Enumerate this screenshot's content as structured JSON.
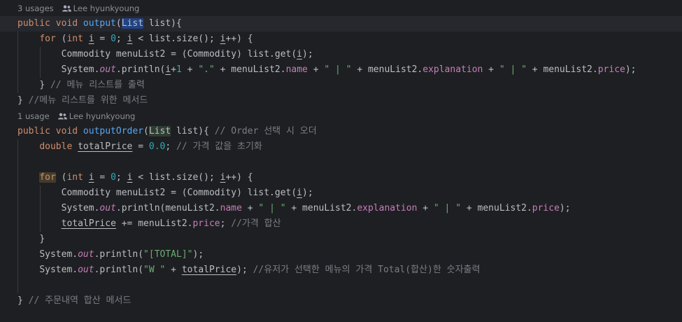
{
  "editor": {
    "hint1": {
      "usages": "3 usages",
      "author": "Lee hyunkyoung"
    },
    "hint2": {
      "usages": "1 usage",
      "author": "Lee hyunkyoung"
    },
    "code": {
      "l1": {
        "a": "public void ",
        "b": "output",
        "c": "(",
        "d": "List",
        "e": " list){"
      },
      "l2": {
        "a": "for",
        "b": " (",
        "c": "int",
        "d": " ",
        "e": "i",
        "f": " = ",
        "g": "0",
        "h": "; ",
        "i": "i",
        "j": " < list.size(); ",
        "k": "i",
        "l": "++) {"
      },
      "l3": {
        "a": "Commodity menuList2 = (Commodity) list.get(",
        "b": "i",
        "c": ");"
      },
      "l4": {
        "a": "System.",
        "b": "out",
        "c": ".println(",
        "d": "i",
        "e": "+",
        "f": "1",
        "g": " + ",
        "h": "\".\"",
        "i": " + menuList2.",
        "j": "name",
        "k": " + ",
        "l": "\" | \"",
        "m": " + menuList2.",
        "n": "explanation",
        "o": " + ",
        "p": "\" | \"",
        "q": " + menuList2.",
        "r": "price",
        "s": ");"
      },
      "l5": {
        "a": "} ",
        "b": "// 메뉴 리스트를 출력"
      },
      "l6": {
        "a": "} ",
        "b": "//메뉴 리스트를 위한 메서드"
      },
      "l7": {
        "a": "public void ",
        "b": "outputOrder",
        "c": "(",
        "d": "List",
        "e": " list){ ",
        "f": "// Order 선택 시 오더"
      },
      "l8": {
        "a": "double ",
        "b": "totalPrice",
        "c": " = ",
        "d": "0.0",
        "e": "; ",
        "f": "// 가격 값을 초기화"
      },
      "l10": {
        "a": "for",
        "b": " (",
        "c": "int",
        "d": " ",
        "e": "i",
        "f": " = ",
        "g": "0",
        "h": "; ",
        "i": "i",
        "j": " < list.size(); ",
        "k": "i",
        "l": "++) {"
      },
      "l11": {
        "a": "Commodity menuList2 = (Commodity) list.get(",
        "b": "i",
        "c": ");"
      },
      "l12": {
        "a": "System.",
        "b": "out",
        "c": ".println(menuList2.",
        "d": "name",
        "e": " + ",
        "f": "\" | \"",
        "g": " + menuList2.",
        "h": "explanation",
        "i": " + ",
        "j": "\" | \"",
        "k": " + menuList2.",
        "l": "price",
        "m": ");"
      },
      "l13": {
        "a": "totalPrice",
        "b": " += menuList2.",
        "c": "price",
        "d": "; ",
        "e": "//가격 합산"
      },
      "l14": {
        "a": "}"
      },
      "l15": {
        "a": "System.",
        "b": "out",
        "c": ".println(",
        "d": "\"[TOTAL]\"",
        "e": ");"
      },
      "l16": {
        "a": "System.",
        "b": "out",
        "c": ".println(",
        "d": "\"W \"",
        "e": " + ",
        "f": "totalPrice",
        "g": "); ",
        "h": "//유저가 선택한 메뉴의 가격 Total(합산)한 숫자출력"
      },
      "l18": {
        "a": "} ",
        "b": "// 주문내역 합산 메서드"
      }
    }
  }
}
